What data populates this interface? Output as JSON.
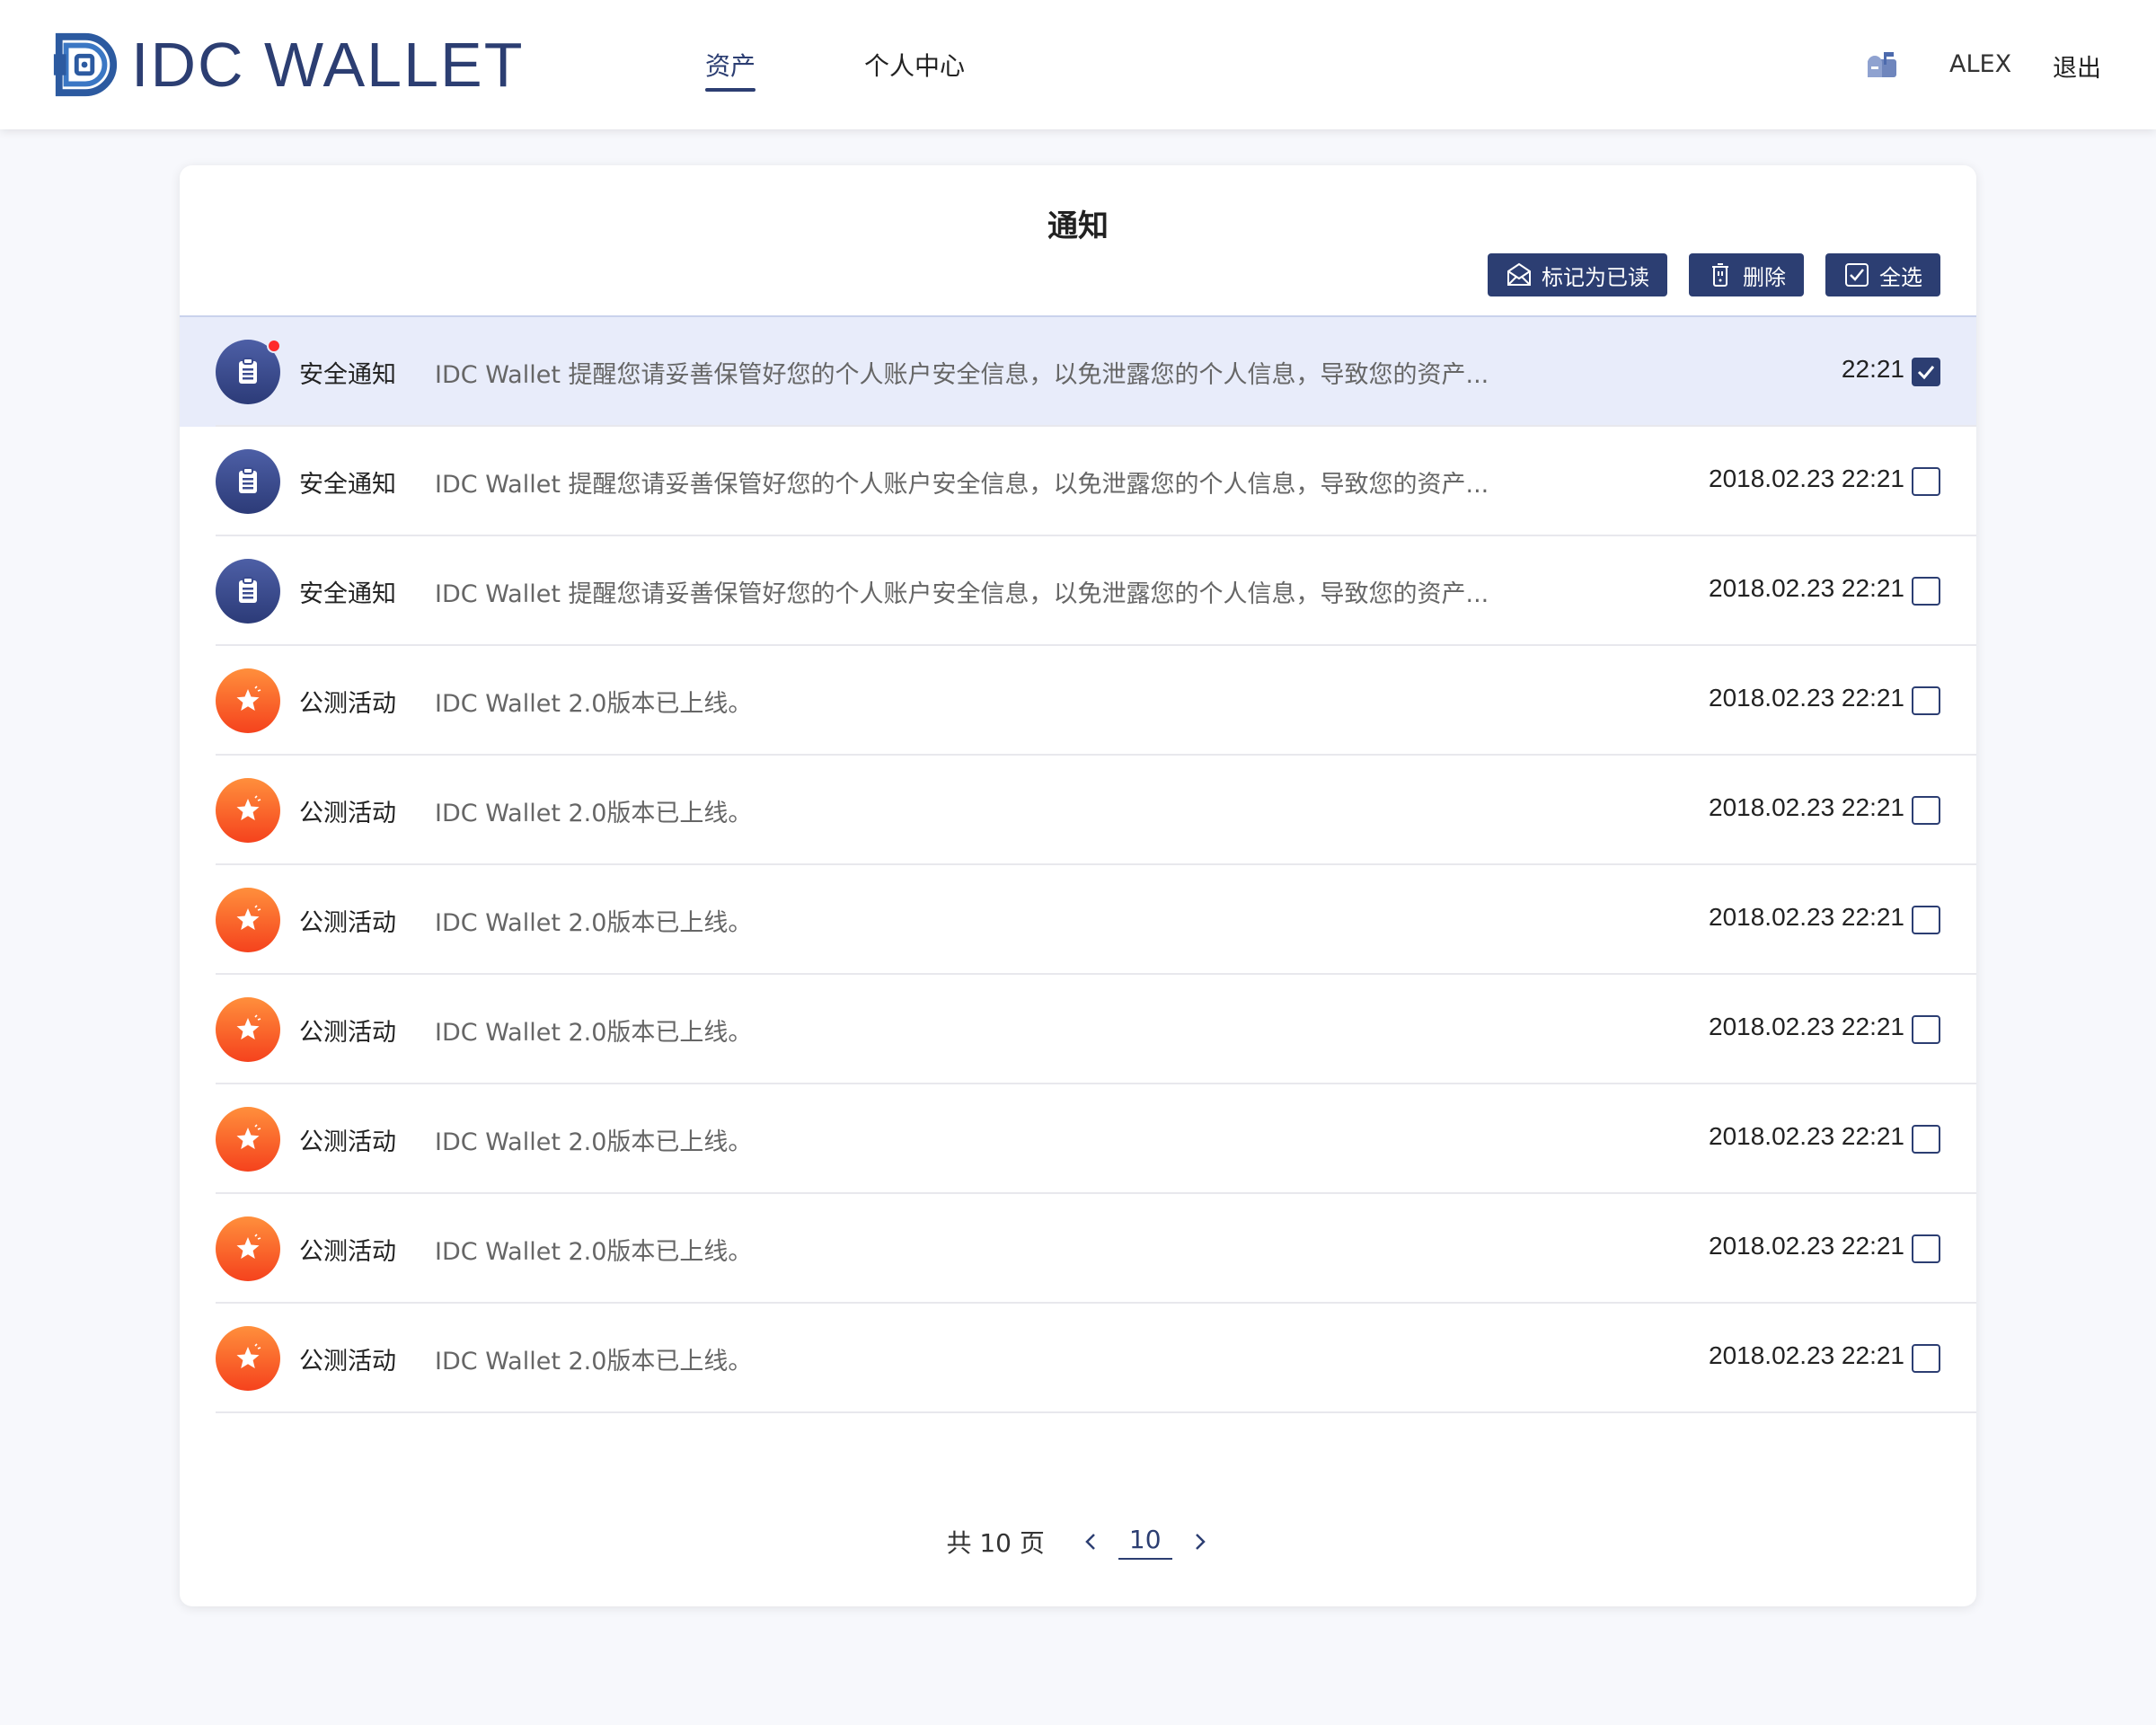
{
  "header": {
    "logo_text": "IDC WALLET",
    "nav": [
      {
        "label": "资产",
        "active": true
      },
      {
        "label": "个人中心",
        "active": false
      }
    ],
    "mail_icon": "mailbox-icon",
    "username": "ALEX",
    "logout": "退出"
  },
  "notifications": {
    "title": "通知",
    "actions": {
      "mark_read": "标记为已读",
      "delete": "删除",
      "select_all": "全选"
    },
    "items": [
      {
        "type": "安全通知",
        "icon": "clipboard-icon",
        "content": "IDC Wallet 提醒您请妥善保管好您的个人账户安全信息，以免泄露您的个人信息，导致您的资产...",
        "time": "22:21",
        "checked": true,
        "unread": true
      },
      {
        "type": "安全通知",
        "icon": "clipboard-icon",
        "content": "IDC Wallet 提醒您请妥善保管好您的个人账户安全信息，以免泄露您的个人信息，导致您的资产...",
        "time": "2018.02.23 22:21",
        "checked": false,
        "unread": false
      },
      {
        "type": "安全通知",
        "icon": "clipboard-icon",
        "content": "IDC Wallet 提醒您请妥善保管好您的个人账户安全信息，以免泄露您的个人信息，导致您的资产...",
        "time": "2018.02.23 22:21",
        "checked": false,
        "unread": false
      },
      {
        "type": "公测活动",
        "icon": "star-icon",
        "content": "IDC Wallet 2.0版本已上线。",
        "time": "2018.02.23 22:21",
        "checked": false,
        "unread": false
      },
      {
        "type": "公测活动",
        "icon": "star-icon",
        "content": "IDC Wallet 2.0版本已上线。",
        "time": "2018.02.23 22:21",
        "checked": false,
        "unread": false
      },
      {
        "type": "公测活动",
        "icon": "star-icon",
        "content": "IDC Wallet 2.0版本已上线。",
        "time": "2018.02.23 22:21",
        "checked": false,
        "unread": false
      },
      {
        "type": "公测活动",
        "icon": "star-icon",
        "content": "IDC Wallet 2.0版本已上线。",
        "time": "2018.02.23 22:21",
        "checked": false,
        "unread": false
      },
      {
        "type": "公测活动",
        "icon": "star-icon",
        "content": "IDC Wallet 2.0版本已上线。",
        "time": "2018.02.23 22:21",
        "checked": false,
        "unread": false
      },
      {
        "type": "公测活动",
        "icon": "star-icon",
        "content": "IDC Wallet 2.0版本已上线。",
        "time": "2018.02.23 22:21",
        "checked": false,
        "unread": false
      },
      {
        "type": "公测活动",
        "icon": "star-icon",
        "content": "IDC Wallet 2.0版本已上线。",
        "time": "2018.02.23 22:21",
        "checked": false,
        "unread": false
      }
    ]
  },
  "pagination": {
    "total_label": "共 10 页",
    "current": "10"
  },
  "colors": {
    "brand": "#2c3e72",
    "security_icon": "#3a4b8f",
    "activity_icon": "#f85a2a",
    "selected_row": "#e8ecfa",
    "unread_dot": "#ff2a2a"
  }
}
